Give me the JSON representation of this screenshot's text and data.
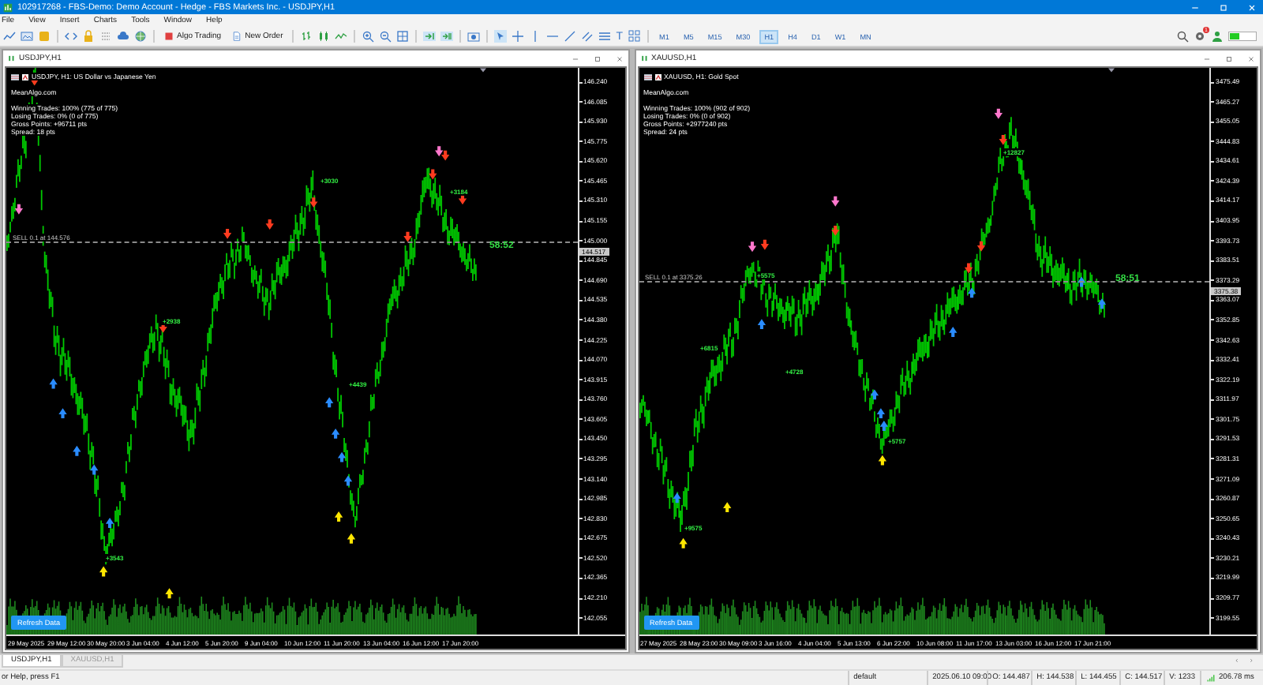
{
  "window": {
    "title": "102917268 - FBS-Demo: Demo Account - Hedge - FBS Markets Inc. - USDJPY,H1"
  },
  "menu": [
    "File",
    "View",
    "Insert",
    "Charts",
    "Tools",
    "Window",
    "Help"
  ],
  "toolbar": {
    "algo_trading": "Algo Trading",
    "new_order": "New Order",
    "text_tool": "T",
    "notifications": "1",
    "timeframes": [
      {
        "label": "M1",
        "selected": false
      },
      {
        "label": "M5",
        "selected": false
      },
      {
        "label": "M15",
        "selected": false
      },
      {
        "label": "M30",
        "selected": false
      },
      {
        "label": "H1",
        "selected": true
      },
      {
        "label": "H4",
        "selected": false
      },
      {
        "label": "D1",
        "selected": false
      },
      {
        "label": "W1",
        "selected": false
      },
      {
        "label": "MN",
        "selected": false
      }
    ]
  },
  "charts": [
    {
      "title": "USDJPY,H1",
      "symbol_line": "USDJPY, H1: US Dollar vs Japanese Yen",
      "site": "MeanAlgo.com",
      "stats": [
        "Winning Trades: 100% (775 of 775)",
        "Losing Trades: 0% (0 of 775)",
        "Gross Points: +96711 pts",
        "Spread: 18 pts"
      ],
      "order_line": "SELL 0.1 at 144.576",
      "countdown": "58:52",
      "current_price": "144.517",
      "refresh_button": "Refresh Data",
      "trade_labels": [
        "+3030",
        "+3184",
        "+2938",
        "+4439",
        "+3543"
      ],
      "price_axis": [
        "146.240",
        "146.085",
        "145.930",
        "145.775",
        "145.620",
        "145.465",
        "145.310",
        "145.155",
        "145.000",
        "144.845",
        "144.690",
        "144.535",
        "144.380",
        "144.225",
        "144.070",
        "143.915",
        "143.760",
        "143.605",
        "143.450",
        "143.295",
        "143.140",
        "142.985",
        "142.830",
        "142.675",
        "142.520",
        "142.365",
        "142.210",
        "142.055"
      ],
      "time_axis": [
        "29 May 2025",
        "29 May 12:00",
        "30 May 20:00",
        "3 Jun 04:00",
        "4 Jun 12:00",
        "5 Jun 20:00",
        "9 Jun 04:00",
        "10 Jun 12:00",
        "11 Jun 20:00",
        "13 Jun 04:00",
        "16 Jun 12:00",
        "17 Jun 20:00"
      ]
    },
    {
      "title": "XAUUSD,H1",
      "symbol_line": "XAUUSD, H1: Gold Spot",
      "site": "MeanAlgo.com",
      "stats": [
        "Winning Trades: 100% (902 of 902)",
        "Losing Trades: 0% (0 of 902)",
        "Gross Points: +2977240 pts",
        "Spread: 24 pts"
      ],
      "order_line": "SELL 0.1 at 3375.26",
      "countdown": "58:51",
      "current_price": "3375.38",
      "refresh_button": "Refresh Data",
      "trade_labels": [
        "+12827",
        "+5575",
        "+6815",
        "+4728",
        "+5757",
        "+9575"
      ],
      "price_axis": [
        "3475.49",
        "3465.27",
        "3455.05",
        "3444.83",
        "3434.61",
        "3424.39",
        "3414.17",
        "3403.95",
        "3393.73",
        "3383.51",
        "3373.29",
        "3363.07",
        "3352.85",
        "3342.63",
        "3332.41",
        "3322.19",
        "3311.97",
        "3301.75",
        "3291.53",
        "3281.31",
        "3271.09",
        "3260.87",
        "3250.65",
        "3240.43",
        "3230.21",
        "3219.99",
        "3209.77",
        "3199.55"
      ],
      "time_axis": [
        "27 May 2025",
        "28 May 23:00",
        "30 May 09:00",
        "3 Jun 16:00",
        "4 Jun 04:00",
        "5 Jun 13:00",
        "6 Jun 22:00",
        "10 Jun 08:00",
        "11 Jun 17:00",
        "13 Jun 03:00",
        "16 Jun 12:00",
        "17 Jun 21:00"
      ]
    }
  ],
  "tabs": [
    {
      "label": "USDJPY,H1",
      "selected": true
    },
    {
      "label": "XAUUSD,H1",
      "selected": false
    }
  ],
  "status_bar": {
    "help": "or Help, press F1",
    "profile": "default",
    "time": "2025.06.10 09:00",
    "open": "O: 144.487",
    "high": "H: 144.538",
    "low": "L: 144.455",
    "close": "C: 144.517",
    "volume": "V: 1233",
    "ping": "206.78 ms"
  }
}
